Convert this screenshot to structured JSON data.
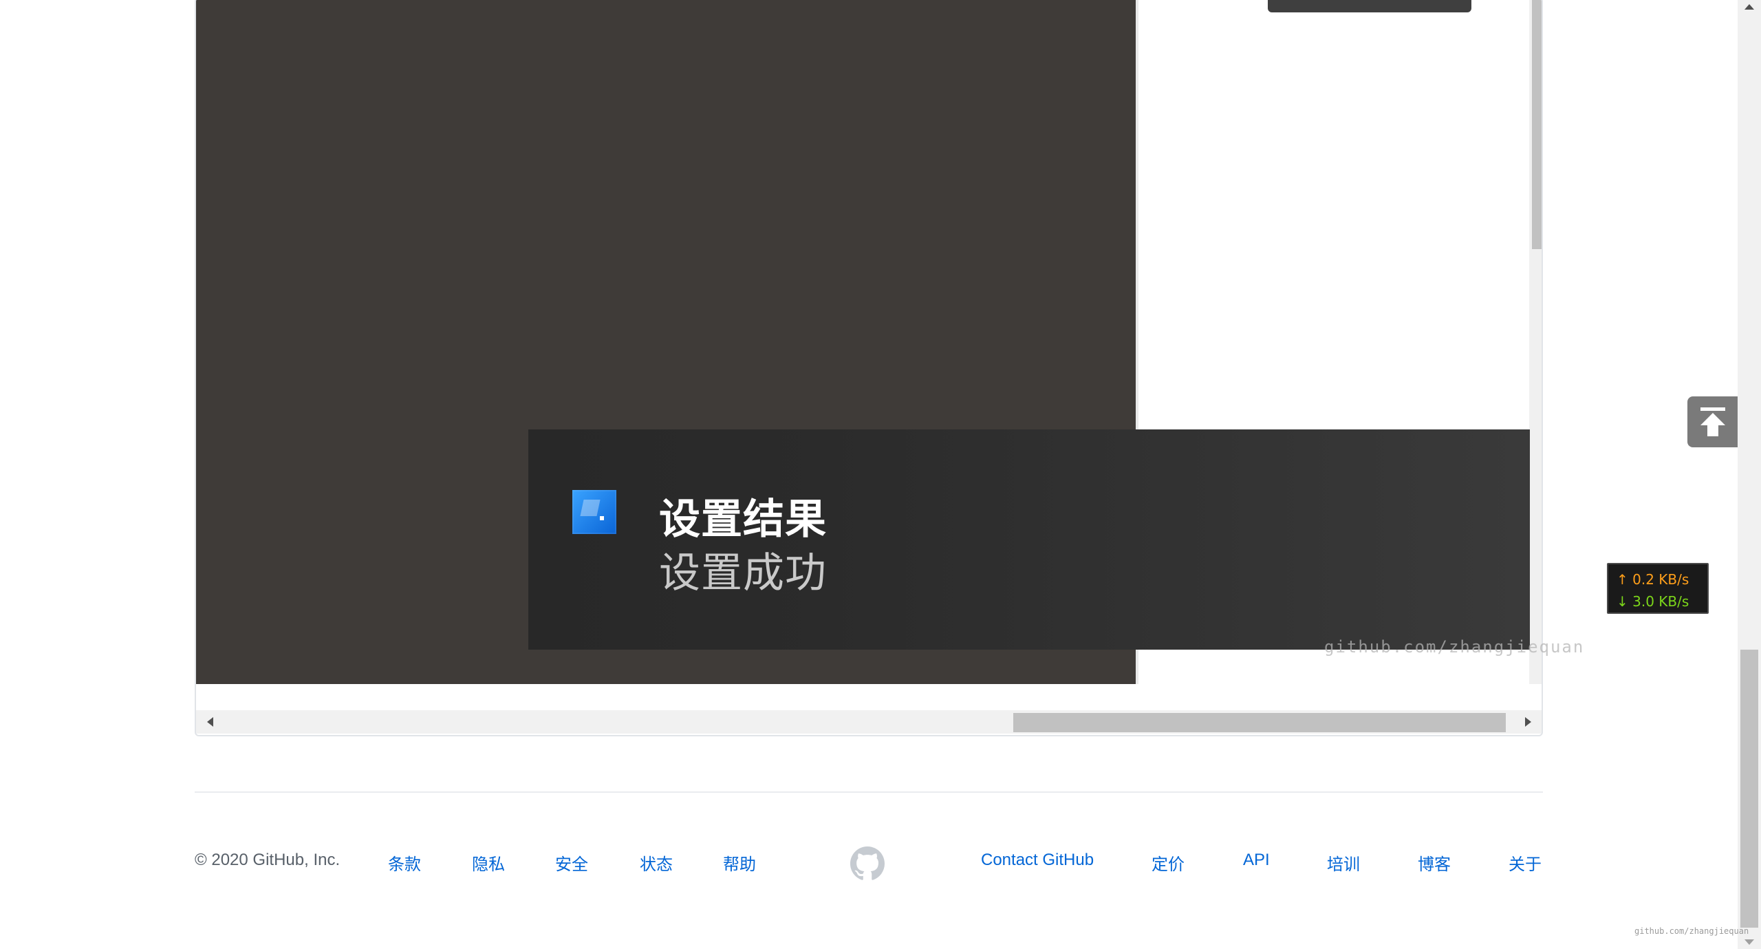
{
  "toast": {
    "title": "设置结果",
    "body": "设置成功",
    "icon": "app-icon"
  },
  "watermark": {
    "inner": "github.com/zhangjiequan",
    "corner": "github.com/zhangjiequan"
  },
  "footer": {
    "copyright": "© 2020 GitHub, Inc.",
    "left_links": [
      "条款",
      "隐私",
      "安全",
      "状态",
      "帮助"
    ],
    "right_links": [
      "Contact GitHub",
      "定价",
      "API",
      "培训",
      "博客",
      "关于"
    ],
    "logo_icon": "github-mark-icon"
  },
  "net_speed": {
    "up": "↑ 0.2 KB/s",
    "down": "↓ 3.0 KB/s"
  },
  "colors": {
    "link": "#0366d6",
    "canvas_dark": "#3f3b38",
    "toast_bg": "#2b2b2b",
    "net_up": "#ff9f1a",
    "net_down": "#7cd61a"
  }
}
